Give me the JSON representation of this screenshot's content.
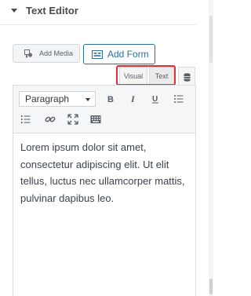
{
  "section": {
    "title": "Text Editor",
    "caret_icon": "caret-down-icon"
  },
  "buttons": {
    "add_media": {
      "label": "Add Media",
      "icon": "media-icon"
    },
    "add_form": {
      "label": "Add Form",
      "icon": "form-icon"
    }
  },
  "tabs": {
    "visual": "Visual",
    "text": "Text",
    "active": "visual"
  },
  "toolbar": {
    "format": "Paragraph",
    "buttons": [
      {
        "name": "bold",
        "glyph": "B",
        "icon": "bold-icon"
      },
      {
        "name": "italic",
        "glyph": "I",
        "icon": "italic-icon"
      },
      {
        "name": "underline",
        "glyph": "U",
        "icon": "underline-icon"
      },
      {
        "name": "bullet-list",
        "icon": "bullet-list-icon"
      },
      {
        "name": "numbered-list",
        "icon": "numbered-list-icon"
      },
      {
        "name": "link",
        "icon": "link-icon"
      },
      {
        "name": "fullscreen",
        "icon": "fullscreen-icon"
      },
      {
        "name": "toolbar-toggle",
        "icon": "keyboard-icon"
      }
    ]
  },
  "editor": {
    "content": "Lorem ipsum dolor sit amet, consectetur adipiscing elit. Ut elit tellus, luctus nec ullamcorper mattis, pulvinar dapibus leo."
  },
  "colors": {
    "accent": "#2e6e9e",
    "highlight": "#e0303a"
  }
}
